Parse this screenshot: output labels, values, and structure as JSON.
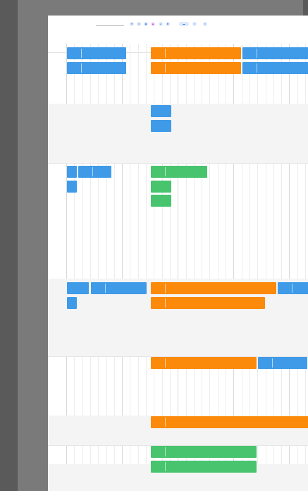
{
  "header": {
    "field_a_label": "",
    "field_a_value": "",
    "field_b_label": "",
    "field_b_value": "",
    "zoom_label": "",
    "month_left": "",
    "month_right": "",
    "today_label": "",
    "toolbar_icons": [
      "filter-icon",
      "list-icon",
      "grid-icon",
      "calendar-icon",
      "user-icon",
      "settings-icon",
      "tag-icon",
      "export-icon",
      "share-icon"
    ]
  },
  "days": [
    "",
    "",
    "",
    "",
    "",
    "",
    "",
    "",
    "",
    "",
    "",
    "",
    "",
    "",
    "",
    "",
    "",
    "",
    "",
    "",
    "",
    "",
    "",
    "",
    "",
    "",
    "",
    "",
    "",
    "",
    ""
  ],
  "rows": [
    {
      "label": "",
      "sub": ""
    },
    {
      "label": "",
      "sub": ""
    },
    {
      "label": "",
      "sub": ""
    },
    {
      "label": "",
      "sub": ""
    },
    {
      "label": "",
      "sub": ""
    },
    {
      "label": "",
      "sub": ""
    },
    {
      "label": "",
      "sub": ""
    },
    {
      "label": "",
      "sub": ""
    }
  ],
  "event_text": {
    "title": "",
    "detail": ""
  },
  "colors": {
    "blue": "#3f9be8",
    "orange": "#fb8a0a",
    "green": "#48c46e",
    "today": "#e84b3b"
  }
}
